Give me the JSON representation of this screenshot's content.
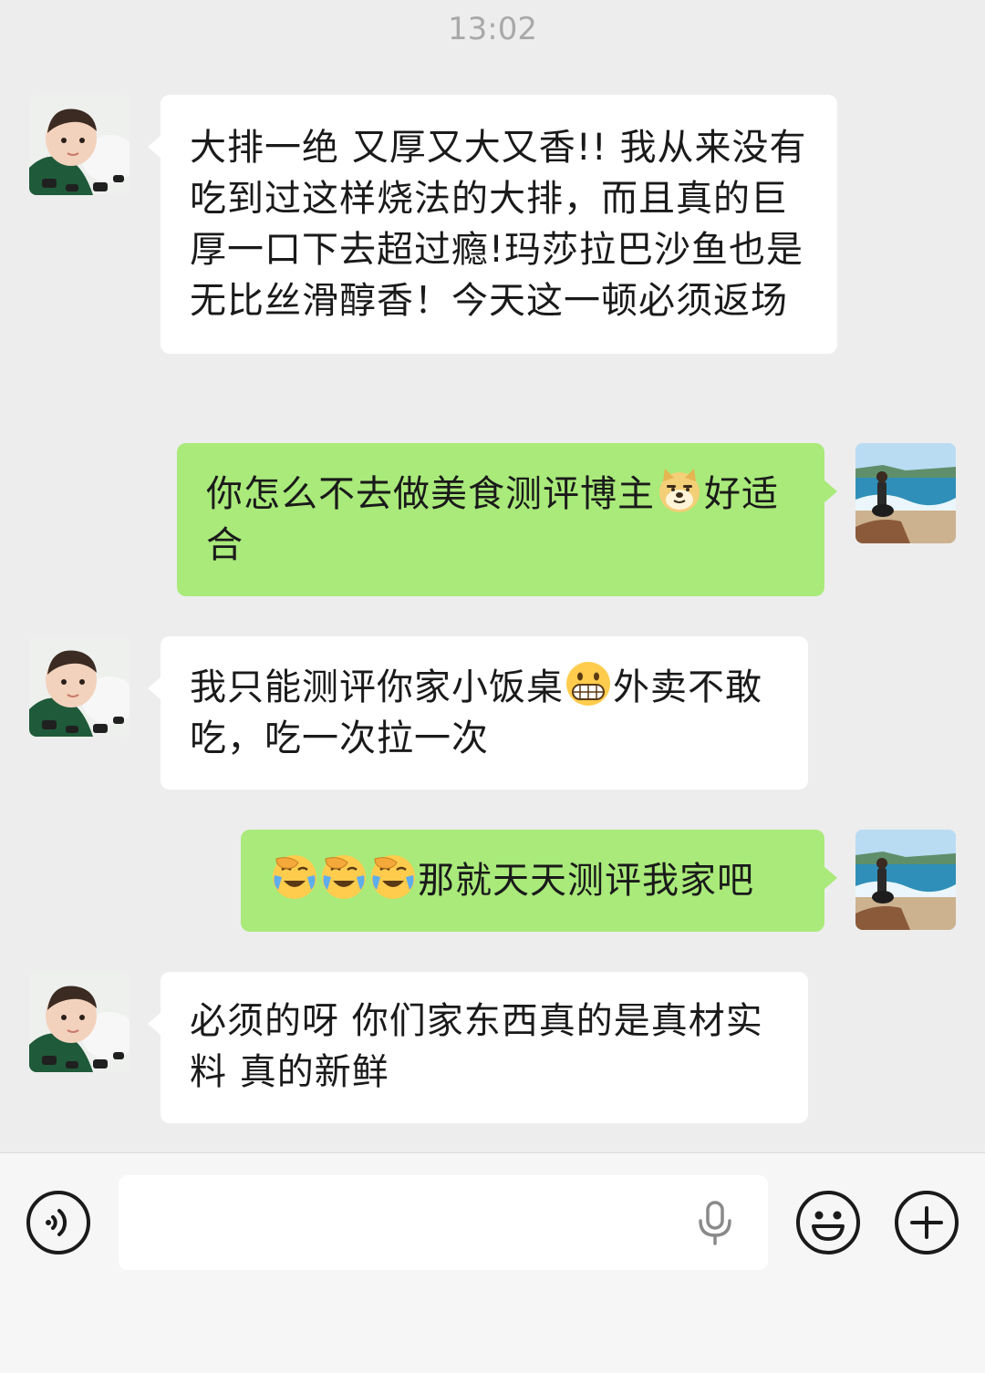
{
  "chat": {
    "timestamp": "13:02",
    "messages": [
      {
        "side": "left",
        "text": "大排一绝 又厚又大又香!! 我从来没有吃到过这样烧法的大排，而且真的巨厚一口下去超过瘾!玛莎拉巴沙鱼也是无比丝滑醇香！今天这一顿必须返场"
      },
      {
        "side": "right",
        "text_before": "你怎么不去做美食测评博主",
        "emoji": "doge-emoji",
        "text_after": "好适合"
      },
      {
        "side": "left",
        "text_before": "我只能测评你家小饭桌",
        "emoji": "grimace-emoji",
        "text_after": "外卖不敢吃，吃一次拉一次"
      },
      {
        "side": "right",
        "emojis": [
          "facepalm-cry-emoji",
          "facepalm-cry-emoji",
          "facepalm-cry-emoji"
        ],
        "text": "那就天天测评我家吧"
      },
      {
        "side": "left",
        "text": "必须的呀 你们家东西真的是真材实料 真的新鲜"
      }
    ]
  },
  "input_bar": {
    "voice_icon": "voice-toggle-icon",
    "input_value": "",
    "mic_icon": "microphone-icon",
    "emoji_icon": "smiley-icon",
    "plus_icon": "plus-icon"
  },
  "colors": {
    "background": "#ededed",
    "own_bubble": "#a9ea7a",
    "other_bubble": "#ffffff",
    "timestamp": "#a9a9a9"
  }
}
